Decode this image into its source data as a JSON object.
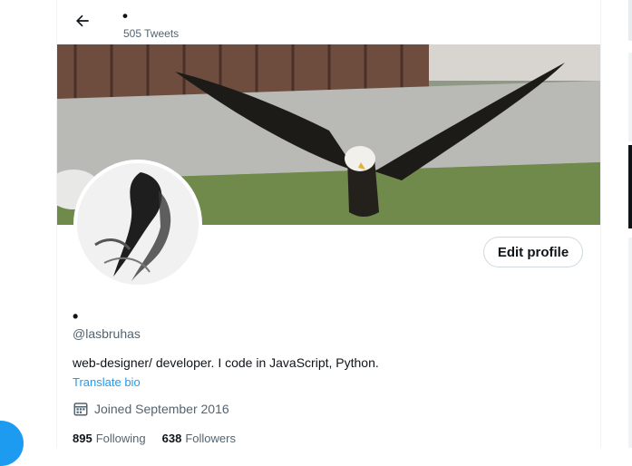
{
  "header": {
    "back_icon": "arrow-left-icon",
    "display_name": "•",
    "tweet_count": "505 Tweets"
  },
  "profile": {
    "display_name": "•",
    "handle": "@lasbruhas",
    "bio": "web-designer/ developer. I code in JavaScript, Python.",
    "translate_label": "Translate bio",
    "joined": "Joined September 2016",
    "calendar_icon": "calendar-icon",
    "edit_label": "Edit profile"
  },
  "stats": {
    "following_count": "895",
    "following_label": "Following",
    "followers_count": "638",
    "followers_label": "Followers"
  },
  "colors": {
    "accent": "#1d9bf0",
    "text": "#0f1419",
    "secondary_text": "#536471",
    "border": "#cfd9de"
  }
}
